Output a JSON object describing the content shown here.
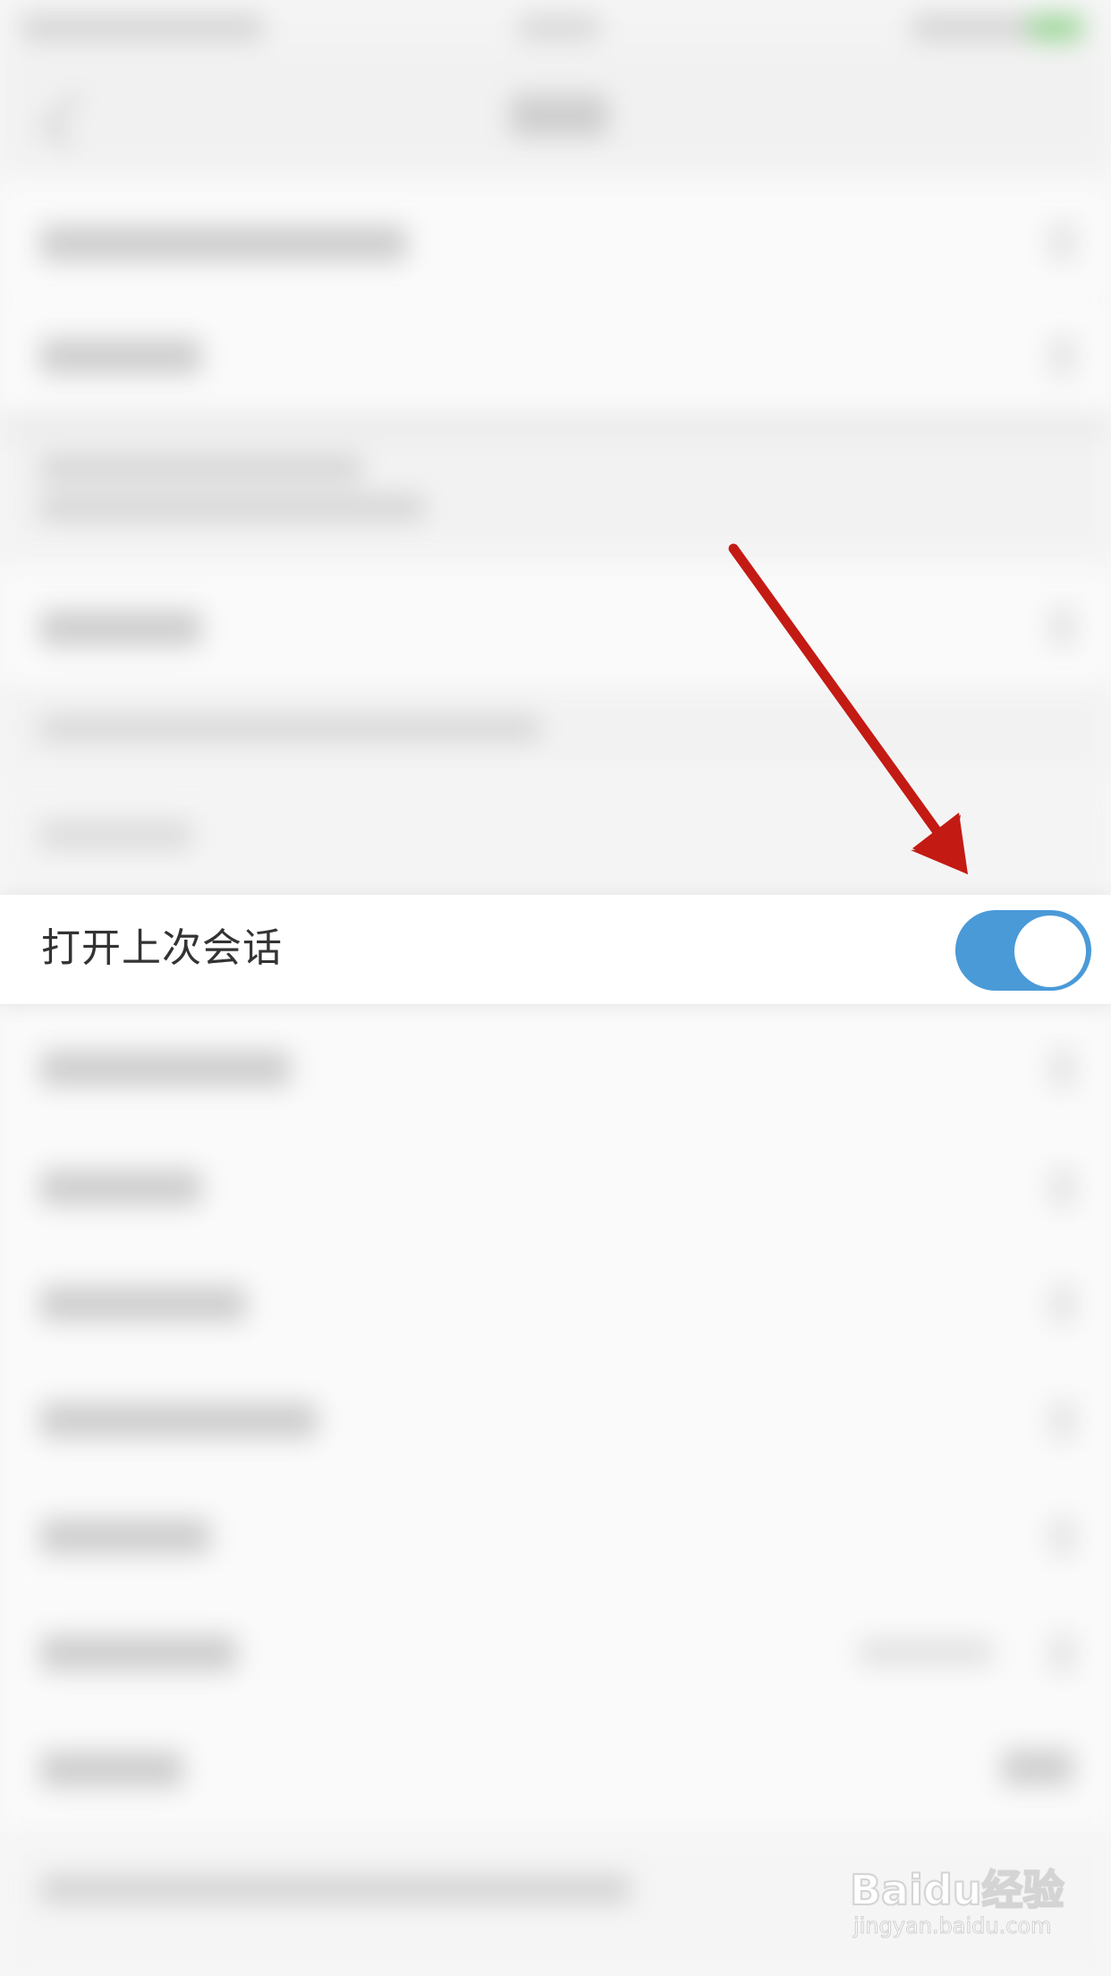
{
  "highlighted_setting": {
    "label": "打开上次会话",
    "toggle_state": "on",
    "toggle_color": "#4a9ad8"
  },
  "annotation": {
    "type": "arrow",
    "color": "#c41a14"
  },
  "watermark": {
    "brand": "Baidu经验",
    "url": "jingyan.baidu.com"
  }
}
